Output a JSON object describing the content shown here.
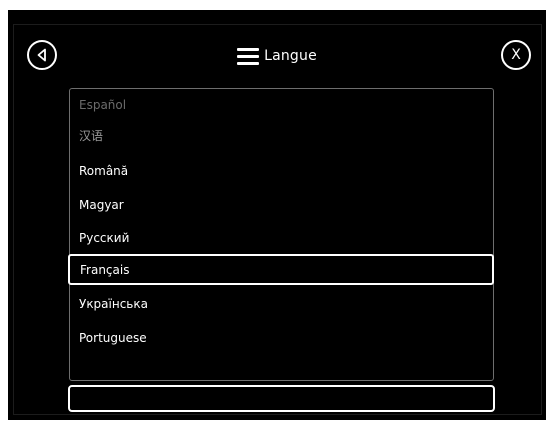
{
  "header": {
    "title": "Langue",
    "back_icon": "back-arrow-icon",
    "close_label": "X",
    "menu_icon": "hamburger-menu-icon"
  },
  "languages": [
    {
      "label": "Español",
      "state": "faded"
    },
    {
      "label": "汉语",
      "state": "dim"
    },
    {
      "label": "Română",
      "state": "normal"
    },
    {
      "label": "Magyar",
      "state": "normal"
    },
    {
      "label": "Русский",
      "state": "normal"
    },
    {
      "label": "Français",
      "state": "selected"
    },
    {
      "label": "Українська",
      "state": "normal"
    },
    {
      "label": "Portuguese",
      "state": "normal"
    }
  ],
  "colors": {
    "background": "#000000",
    "text": "#ffffff",
    "list_border": "#6e6e6e",
    "faded_text": "#6b6b6b"
  }
}
